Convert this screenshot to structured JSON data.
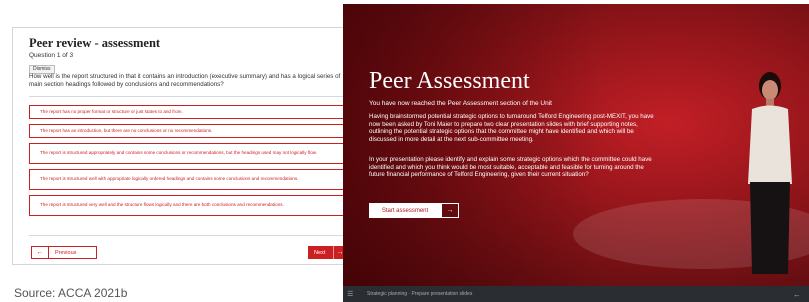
{
  "left_panel": {
    "title": "Peer review - assessment",
    "subtitle": "Question 1 of 3",
    "dismiss_label": "Dismiss",
    "question": "How well is the report structured in that it contains an introduction (executive summary) and has a logical series of main section headings followed by conclusions and recommendations?",
    "options": [
      "The report has no proper format or structure or just states to and from.",
      "The report has an introduction, but there are no conclusions or no recommendations.",
      "The report is structured appropriately and contains some conclusions or recommendations, but the headings used may not logically flow.",
      "The report is structured well with appropriate logically ordered headings and contains some conclusions and recommendations.",
      "The report is structured very well and the structure flows logically and there are both conclusions and recommendations."
    ],
    "previous_label": "Previous",
    "next_label": "Next",
    "arrow_left": "←",
    "arrow_right": "→"
  },
  "source": "Source: ACCA 2021b",
  "right_panel": {
    "title": "Peer Assessment",
    "intro": "You have now reached the Peer Assessment section of the Unit",
    "paragraph1": "Having brainstormed potential strategic options to turnaround Telford Engineering post-MEXIT, you have now been asked by Toni Maier to prepare two clear presentation slides with brief supporting notes, outlining the potential strategic options that the committee might have identified and which will be discussed in more detail at the next sub-committee meeting.",
    "paragraph2": "In your presentation please identify and explain some strategic options which the committee could have identified and which you think would be most suitable, acceptable and feasible for turning around the future financial performance of Telford Engineering, given their current situation?",
    "start_label": "Start assessment",
    "start_arrow": "→",
    "breadcrumb": "Strategic planning  ·  Prepare presentation slides",
    "menu_icon_glyph": "☰",
    "back_icon_glyph": "←"
  },
  "colors": {
    "accent_red": "#cc1f22",
    "panel_red": "#8e1419"
  }
}
